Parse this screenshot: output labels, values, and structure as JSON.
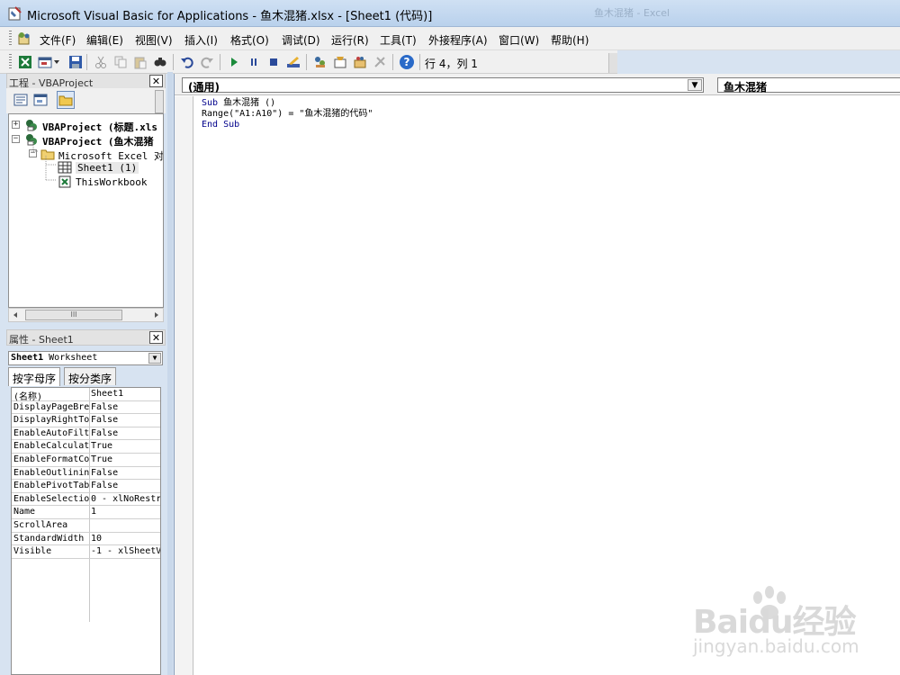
{
  "window": {
    "title": "Microsoft Visual Basic for Applications - 鱼木混猪.xlsx - [Sheet1 (代码)]",
    "ghost_title": "鱼木混猪 - Excel"
  },
  "menu": {
    "items": [
      {
        "label": "文件(F)"
      },
      {
        "label": "编辑(E)"
      },
      {
        "label": "视图(V)"
      },
      {
        "label": "插入(I)"
      },
      {
        "label": "格式(O)"
      },
      {
        "label": "调试(D)"
      },
      {
        "label": "运行(R)"
      },
      {
        "label": "工具(T)"
      },
      {
        "label": "外接程序(A)"
      },
      {
        "label": "窗口(W)"
      },
      {
        "label": "帮助(H)"
      }
    ]
  },
  "toolbar": {
    "position_label": "行 4，列 1",
    "icons": [
      "excel-icon",
      "insert-userform-icon",
      "save-icon",
      "cut-icon",
      "copy-icon",
      "paste-icon",
      "find-icon",
      "undo-icon",
      "redo-icon",
      "run-icon",
      "break-icon",
      "reset-icon",
      "design-mode-icon",
      "project-explorer-icon",
      "properties-window-icon",
      "object-browser-icon",
      "toolbox-icon",
      "help-icon"
    ]
  },
  "project_panel": {
    "title": "工程 - VBAProject",
    "tree": [
      {
        "toggle": "+",
        "label": "VBAProject (标题.xls",
        "bold": true
      },
      {
        "toggle": "−",
        "label": "VBAProject (鱼木混猪",
        "bold": true
      },
      {
        "toggle": "−",
        "label": "Microsoft Excel 对象",
        "bold": false
      },
      {
        "toggle": "",
        "label": "Sheet1 (1)",
        "bold": false
      },
      {
        "toggle": "",
        "label": "ThisWorkbook",
        "bold": false
      }
    ],
    "scroll_thumb": "III"
  },
  "properties_panel": {
    "title": "属性 - Sheet1",
    "object_name": "Sheet1",
    "object_type": "Worksheet",
    "tabs": [
      {
        "label": "按字母序",
        "active": true
      },
      {
        "label": "按分类序",
        "active": false
      }
    ],
    "rows": [
      {
        "name": "(名称)",
        "value": "Sheet1"
      },
      {
        "name": "DisplayPageBre",
        "value": "False"
      },
      {
        "name": "DisplayRightTo",
        "value": "False"
      },
      {
        "name": "EnableAutoFilt",
        "value": "False"
      },
      {
        "name": "EnableCalculat",
        "value": "True"
      },
      {
        "name": "EnableFormatCo",
        "value": "True"
      },
      {
        "name": "EnableOutlinin",
        "value": "False"
      },
      {
        "name": "EnablePivotTab",
        "value": "False"
      },
      {
        "name": "EnableSelectio",
        "value": "0 - xlNoRestr"
      },
      {
        "name": "Name",
        "value": "1"
      },
      {
        "name": "ScrollArea",
        "value": ""
      },
      {
        "name": "StandardWidth",
        "value": "10"
      },
      {
        "name": "Visible",
        "value": "-1 - xlSheetV"
      }
    ]
  },
  "code_window": {
    "object_combo": "(通用)",
    "procedure_combo": "鱼木混猪",
    "lines": [
      {
        "kw": "Sub",
        "text": " 鱼木混猪 ()"
      },
      {
        "kw": "",
        "text": "Range(\"A1:A10\") = \"鱼木混猪的代码\""
      },
      {
        "kw": "End Sub",
        "text": ""
      }
    ]
  },
  "watermark": {
    "brand": "Baidu经验",
    "url": "jingyan.baidu.com"
  }
}
